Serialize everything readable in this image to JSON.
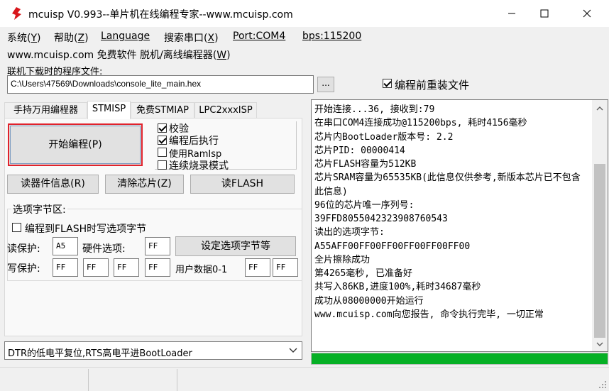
{
  "window": {
    "title": "mcuisp V0.993--单片机在线编程专家--www.mcuisp.com"
  },
  "menu": {
    "system": "系统(",
    "system_key": "Y",
    "help": "帮助(",
    "help_key": "Z",
    "language": "Language",
    "search_port": "搜索串口(",
    "search_port_key": "X",
    "port": "Port:COM4",
    "bps": "bps:115200",
    "close_paren": ")"
  },
  "row2": {
    "site": "www.mcuisp.com",
    "freeware": "免费软件",
    "offline": "脱机/离线编程器(",
    "offline_key": "W",
    "close_paren": ")"
  },
  "file": {
    "label": "联机下载时的程序文件:",
    "path": "C:\\Users\\47569\\Downloads\\console_lite_main.hex",
    "browse": "...",
    "reload_label": "编程前重装文件",
    "reload_checked": true
  },
  "tabs": [
    {
      "label": "手持万用编程器",
      "active": false
    },
    {
      "label": "STMISP",
      "active": true
    },
    {
      "label": "免费STMIAP",
      "active": false
    },
    {
      "label": "LPC2xxxISP",
      "active": false
    }
  ],
  "panel": {
    "start_button": "开始编程(P)",
    "options": [
      {
        "label": "校验",
        "checked": true
      },
      {
        "label": "编程后执行",
        "checked": true
      },
      {
        "label": "使用RamIsp",
        "checked": false
      },
      {
        "label": "连续烧录模式",
        "checked": false
      }
    ],
    "read_info_button": "读器件信息(R)",
    "erase_button": "清除芯片(Z)",
    "read_flash_button": "读FLASH",
    "option_group_title": "选项字节区:",
    "write_option_label": "编程到FLASH时写选项字节",
    "write_option_checked": false,
    "read_protect_label": "读保护:",
    "read_protect_value": "A5",
    "hw_option_label": "硬件选项:",
    "hw_option_value": "FF",
    "set_option_button": "设定选项字节等",
    "write_protect_label": "写保护:",
    "write_protect_values": [
      "FF",
      "FF",
      "FF",
      "FF"
    ],
    "user_data_label": "用户数据0-1",
    "user_data_values": [
      "FF",
      "FF"
    ],
    "reset_mode": "DTR的低电平复位,RTS高电平进BootLoader"
  },
  "log": {
    "text": "开始连接...36, 接收到:79\n在串口COM4连接成功@115200bps, 耗时4156毫秒\n芯片内BootLoader版本号: 2.2\n芯片PID: 00000414\n芯片FLASH容量为512KB\n芯片SRAM容量为65535KB(此信息仅供参考,新版本芯片已不包含此信息)\n96位的芯片唯一序列号:\n39FFD8055042323908760543\n读出的选项字节:\nA55AFF00FF00FF00FF00FF00FF00\n全片擦除成功\n第4265毫秒, 已准备好\n共写入86KB,进度100%,耗时34687毫秒\n成功从08000000开始运行\nwww.mcuisp.com向您报告, 命令执行完毕, 一切正常",
    "progress": 1.0,
    "progress_color": "#06b025"
  }
}
